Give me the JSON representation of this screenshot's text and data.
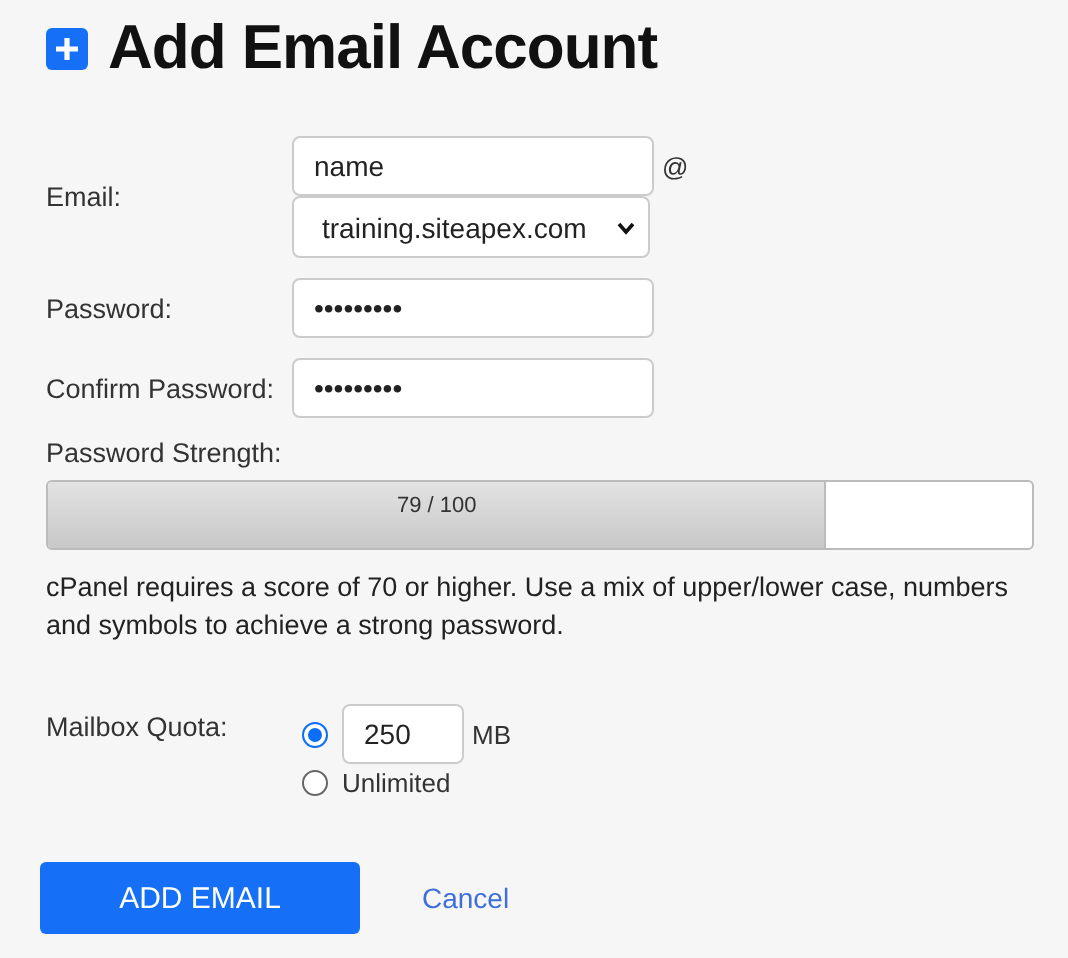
{
  "title": "Add Email Account",
  "email": {
    "label": "Email:",
    "value": "name",
    "at": "@",
    "domain": "training.siteapex.com"
  },
  "password": {
    "label": "Password:",
    "value": "•••••••••"
  },
  "confirm_password": {
    "label": "Confirm Password:",
    "value": "•••••••••"
  },
  "strength": {
    "label": "Password Strength:",
    "level": 0.79,
    "reading": "79 / 100",
    "help": "cPanel requires a score of 70 or higher. Use a mix of upper/lower case, numbers and symbols to achieve a strong password."
  },
  "quota": {
    "label": "Mailbox Quota:",
    "options": [
      {
        "kind": "amount",
        "selected": true,
        "value": "250",
        "unit": "MB"
      },
      {
        "kind": "unlimited",
        "selected": false,
        "label": "Unlimited"
      }
    ]
  },
  "buttons": {
    "submit": "ADD EMAIL",
    "cancel": "Cancel"
  }
}
